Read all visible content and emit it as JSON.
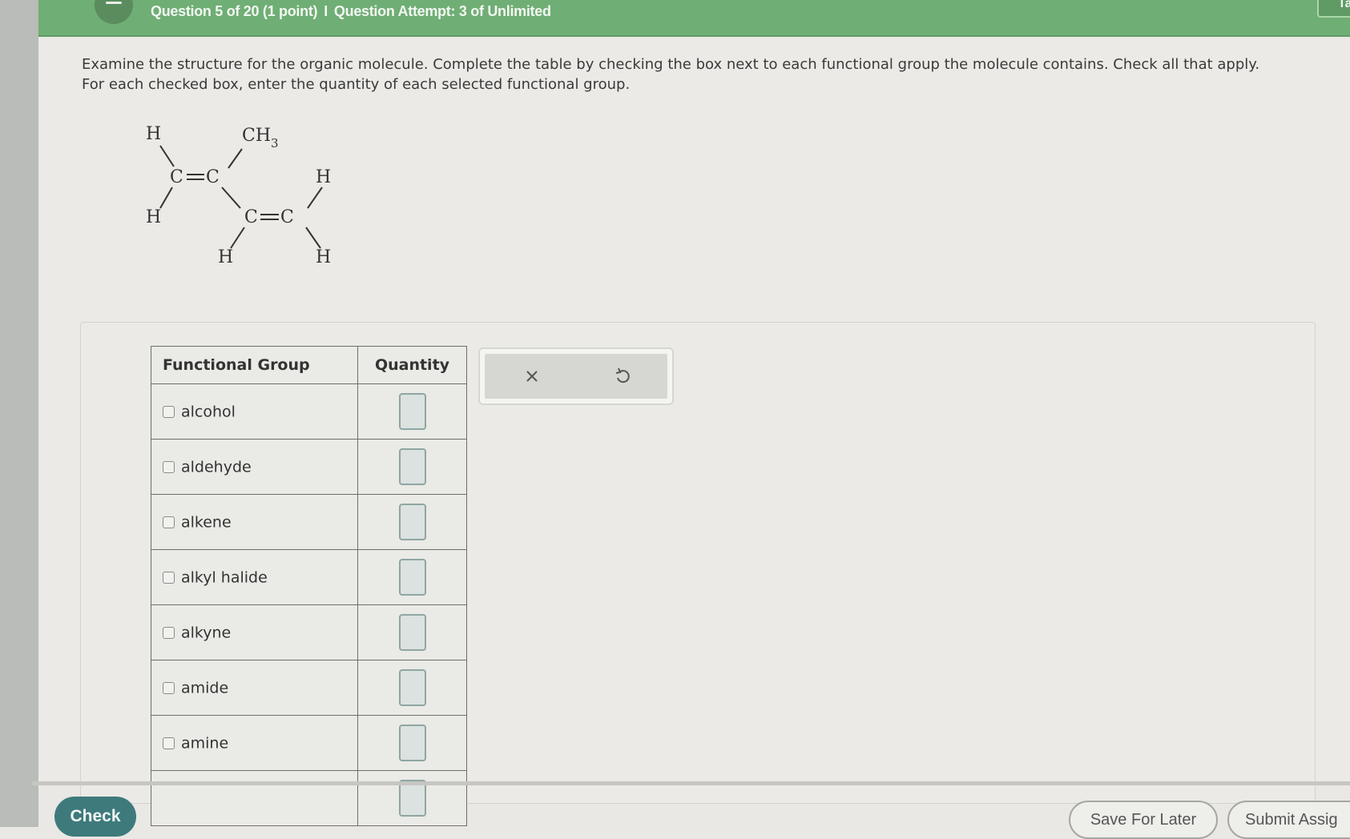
{
  "header": {
    "question_position": "Question 5 of 20 (1 point)",
    "separator": "I",
    "attempt": "Question Attempt: 3 of Unlimited",
    "top_right_button_label": "Taque",
    "accent_color": "#6fae74"
  },
  "prompt": {
    "text": "Examine the structure for the organic molecule. Complete the table by checking the box next to each functional group the molecule contains. Check all that apply. For each checked box, enter the quantity of each selected functional group."
  },
  "molecule": {
    "atoms": {
      "h_top_left": "H",
      "ch3": "CH",
      "ch3_subscript": "3",
      "c1": "C",
      "c2": "C",
      "h_bottom_left": "H",
      "c3": "C",
      "c4": "C",
      "h_right_top": "H",
      "h_bottom_mid": "H",
      "h_bottom_right": "H"
    }
  },
  "table": {
    "headers": {
      "group": "Functional Group",
      "quantity": "Quantity"
    },
    "rows": [
      {
        "label": "alcohol",
        "checked": false,
        "quantity": ""
      },
      {
        "label": "aldehyde",
        "checked": false,
        "quantity": ""
      },
      {
        "label": "alkene",
        "checked": false,
        "quantity": ""
      },
      {
        "label": "alkyl halide",
        "checked": false,
        "quantity": ""
      },
      {
        "label": "alkyne",
        "checked": false,
        "quantity": ""
      },
      {
        "label": "amide",
        "checked": false,
        "quantity": ""
      },
      {
        "label": "amine",
        "checked": false,
        "quantity": ""
      },
      {
        "label": "",
        "checked": false,
        "quantity": ""
      }
    ]
  },
  "toolbar": {
    "clear_icon": "close-icon",
    "undo_icon": "undo-icon"
  },
  "footer": {
    "check_label": "Check",
    "save_label": "Save For Later",
    "submit_label": "Submit Assig",
    "check_color": "#3e7a7c"
  }
}
